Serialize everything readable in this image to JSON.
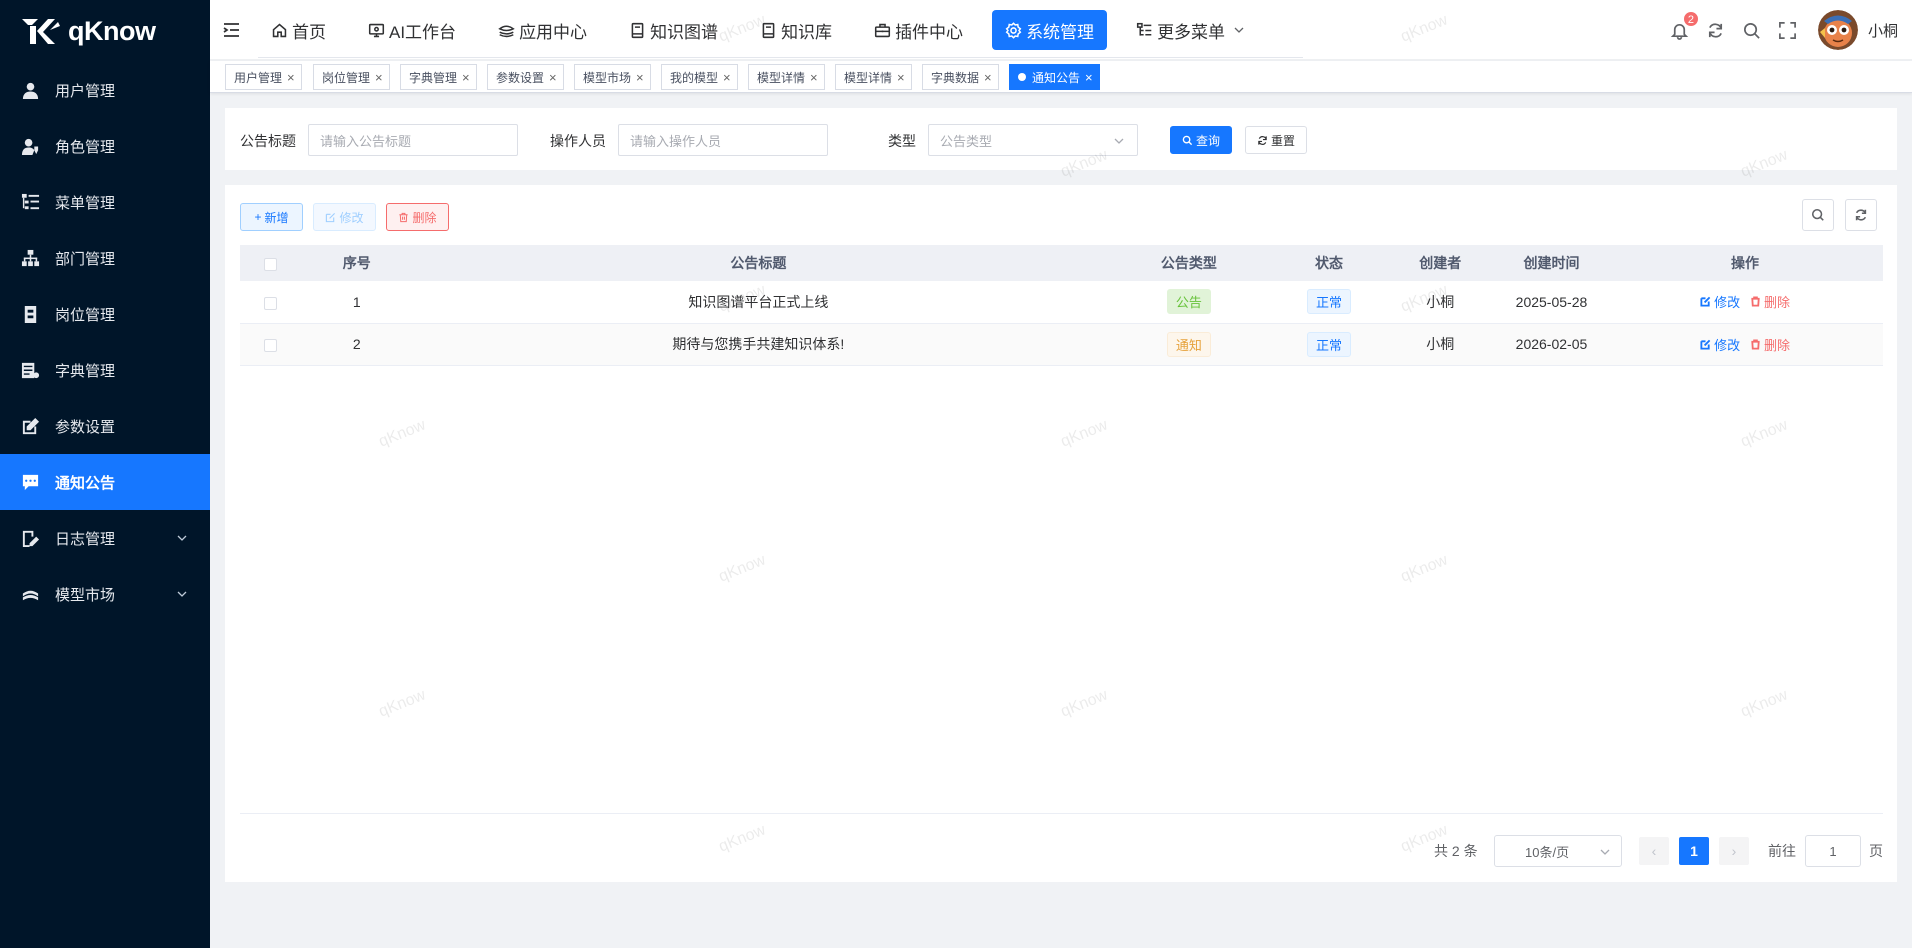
{
  "brand": {
    "name": "qKnow"
  },
  "sidebar": {
    "items": [
      {
        "label": "用户管理",
        "icon": "user-icon"
      },
      {
        "label": "角色管理",
        "icon": "user-role-icon"
      },
      {
        "label": "菜单管理",
        "icon": "tree-menu-icon"
      },
      {
        "label": "部门管理",
        "icon": "org-tree-icon"
      },
      {
        "label": "岗位管理",
        "icon": "post-icon"
      },
      {
        "label": "字典管理",
        "icon": "dict-icon"
      },
      {
        "label": "参数设置",
        "icon": "edit-icon"
      },
      {
        "label": "通知公告",
        "icon": "message-icon",
        "active": true
      },
      {
        "label": "日志管理",
        "icon": "log-icon",
        "expandable": true
      },
      {
        "label": "模型市场",
        "icon": "model-icon",
        "expandable": true
      }
    ]
  },
  "topnav": {
    "items": [
      {
        "label": "首页",
        "icon": "home-icon"
      },
      {
        "label": "AI工作台",
        "icon": "monitor-icon"
      },
      {
        "label": "应用中心",
        "icon": "stack-icon"
      },
      {
        "label": "知识图谱",
        "icon": "book-icon"
      },
      {
        "label": "知识库",
        "icon": "book-icon"
      },
      {
        "label": "插件中心",
        "icon": "briefcase-icon"
      },
      {
        "label": "系统管理",
        "icon": "gear-icon",
        "active": true
      },
      {
        "label": "更多菜单",
        "icon": "tree-icon",
        "dropdown": true
      }
    ],
    "notification_count": "2",
    "username": "小桐"
  },
  "tags": [
    {
      "label": "用户管理"
    },
    {
      "label": "岗位管理"
    },
    {
      "label": "字典管理"
    },
    {
      "label": "参数设置"
    },
    {
      "label": "模型市场"
    },
    {
      "label": "我的模型"
    },
    {
      "label": "模型详情"
    },
    {
      "label": "模型详情"
    },
    {
      "label": "字典数据"
    },
    {
      "label": "通知公告",
      "active": true
    }
  ],
  "search": {
    "title_label": "公告标题",
    "title_placeholder": "请输入公告标题",
    "operator_label": "操作人员",
    "operator_placeholder": "请输入操作人员",
    "type_label": "类型",
    "type_placeholder": "公告类型",
    "query_button": "查询",
    "reset_button": "重置"
  },
  "toolbar": {
    "add_label": "新增",
    "edit_label": "修改",
    "delete_label": "删除"
  },
  "table": {
    "columns": [
      "序号",
      "公告标题",
      "公告类型",
      "状态",
      "创建者",
      "创建时间",
      "操作"
    ],
    "rows": [
      {
        "index": "1",
        "title": "知识图谱平台正式上线",
        "type": "公告",
        "type_color": "green",
        "status": "正常",
        "creator": "小桐",
        "created": "2025-05-28",
        "edit": "修改",
        "delete": "删除"
      },
      {
        "index": "2",
        "title": "期待与您携手共建知识体系!",
        "type": "通知",
        "type_color": "orange",
        "status": "正常",
        "creator": "小桐",
        "created": "2026-02-05",
        "edit": "修改",
        "delete": "删除"
      }
    ]
  },
  "pagination": {
    "total_text": "共 2 条",
    "page_size": "10条/页",
    "current_page": "1",
    "goto_label": "前往",
    "goto_value": "1",
    "page_suffix": "页"
  },
  "watermark": "qKnow",
  "colors": {
    "primary": "#1677ff",
    "sidebar_bg": "#001529",
    "danger": "#f56c6c",
    "success": "#67c23a",
    "warning": "#e6a23c"
  }
}
